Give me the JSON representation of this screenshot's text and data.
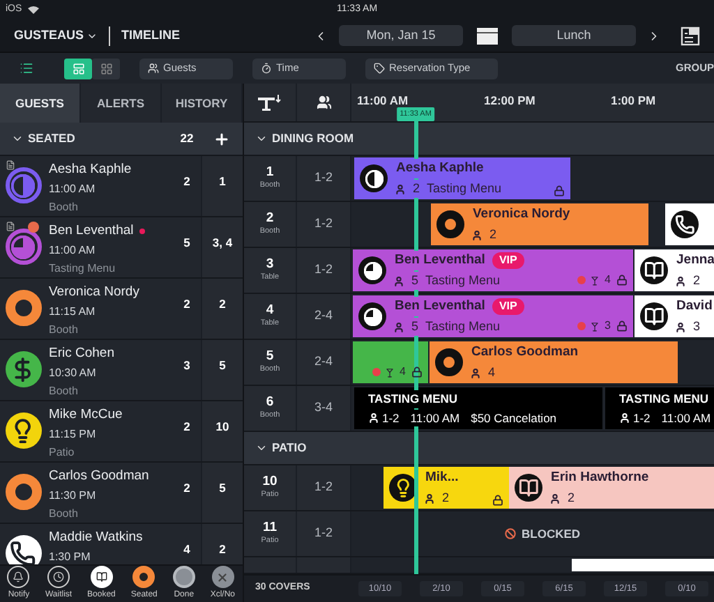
{
  "status_bar": {
    "carrier": "iOS",
    "time": "11:33 AM"
  },
  "header": {
    "venue": "GUSTEAUS",
    "view": "TIMELINE",
    "date": "Mon, Jan 15",
    "shift": "Lunch"
  },
  "toolbar": {
    "views": [
      {
        "kind": "timeline",
        "selected": true
      },
      {
        "kind": "grid",
        "selected": false
      }
    ],
    "filters": [
      {
        "label": "Guests",
        "kind": "guests"
      },
      {
        "label": "Time",
        "kind": "time"
      },
      {
        "label": "Reservation Type",
        "kind": "type"
      }
    ],
    "group": "GROUP"
  },
  "left_tabs": [
    {
      "label": "GUESTS",
      "selected": true
    },
    {
      "label": "ALERTS",
      "selected": false
    },
    {
      "label": "HISTORY",
      "selected": false
    }
  ],
  "section": {
    "title": "SEATED",
    "count": "22",
    "expanded": true
  },
  "guests": [
    {
      "name": "Aesha Kaphle",
      "time": "11:00 AM",
      "note": "Booth",
      "party": "2",
      "table": "1",
      "kind": "half",
      "color": "#7b5cf0",
      "has_note": true,
      "alert": false
    },
    {
      "name": "Ben Leventhal",
      "time": "11:00 AM",
      "note": "Tasting Menu",
      "party": "5",
      "table": "3, 4",
      "kind": "pie",
      "color": "#b450d6",
      "has_note": true,
      "alert": true
    },
    {
      "name": "Veronica Nordy",
      "time": "11:15 AM",
      "note": "Booth",
      "party": "2",
      "table": "2",
      "kind": "ring",
      "color": "#f5883a",
      "has_note": false,
      "alert": false
    },
    {
      "name": "Eric Cohen",
      "time": "10:30 AM",
      "note": "Booth",
      "party": "3",
      "table": "5",
      "kind": "dollar",
      "color": "#45b649",
      "has_note": false,
      "alert": false
    },
    {
      "name": "Mike McCue",
      "time": "11:15 PM",
      "note": "Patio",
      "party": "2",
      "table": "10",
      "kind": "bulb",
      "color": "#f2d40c",
      "has_note": false,
      "alert": false
    },
    {
      "name": "Carlos Goodman",
      "time": "11:30 PM",
      "note": "Booth",
      "party": "2",
      "table": "5",
      "kind": "ring",
      "color": "#f5883a",
      "has_note": false,
      "alert": false
    },
    {
      "name": "Maddie Watkins",
      "time": "1:30 PM",
      "party": "4",
      "table": "2",
      "kind": "phone",
      "color": "#ffffff",
      "has_note": false,
      "alert": false
    }
  ],
  "legend": [
    {
      "label": "Notify",
      "kind": "bell"
    },
    {
      "label": "Waitlist",
      "kind": "clock"
    },
    {
      "label": "Booked",
      "kind": "book"
    },
    {
      "label": "Seated",
      "kind": "seated"
    },
    {
      "label": "Done",
      "kind": "done"
    },
    {
      "label": "Xcl/No",
      "kind": "cancel"
    }
  ],
  "timeline": {
    "times": [
      "11:00 AM",
      "12:00 PM",
      "1:00 PM"
    ],
    "now": "11:33 AM",
    "sections": [
      {
        "title": "DINING ROOM",
        "expanded": true,
        "tables": [
          {
            "number": "1",
            "type": "Booth",
            "size": "1-2",
            "blocks": [
              {
                "kind": "reservation",
                "name": "Aesha Kaphle",
                "party": "2",
                "note": "Tasting Menu",
                "icon": {
                  "kind": "half"
                },
                "color": "#7b5cf0",
                "locked": true,
                "alert": false
              }
            ]
          },
          {
            "number": "2",
            "type": "Booth",
            "size": "1-2",
            "blocks": [
              {
                "kind": "reservation",
                "name": "Veronica Nordy",
                "party": "2",
                "icon": {
                  "kind": "ring"
                },
                "color": "#f5883a",
                "locked": false,
                "alert": false
              },
              {
                "kind": "reservation",
                "icon": {
                  "kind": "phone"
                },
                "color": "#ffffff",
                "locked": false,
                "alert": false
              }
            ]
          },
          {
            "number": "3",
            "type": "Table",
            "size": "1-2",
            "blocks": [
              {
                "kind": "reservation",
                "name": "Ben Leventhal",
                "badge": "VIP",
                "party": "5",
                "note": "Tasting Menu",
                "drinks": "4",
                "icon": {
                  "kind": "pie"
                },
                "color": "#b450d6",
                "locked": true,
                "alert": true
              },
              {
                "kind": "reservation",
                "name": "Jenna",
                "party": "2",
                "icon": {
                  "kind": "book"
                },
                "color": "#ffffff",
                "locked": false,
                "alert": false
              }
            ]
          },
          {
            "number": "4",
            "type": "Table",
            "size": "2-4",
            "blocks": [
              {
                "kind": "reservation",
                "name": "Ben Leventhal",
                "badge": "VIP",
                "party": "5",
                "note": "Tasting Menu",
                "drinks": "3",
                "icon": {
                  "kind": "pie"
                },
                "color": "#b450d6",
                "locked": true,
                "alert": true
              },
              {
                "kind": "reservation",
                "name": "David",
                "party": "3",
                "icon": {
                  "kind": "book"
                },
                "color": "#ffffff",
                "locked": false,
                "alert": false
              }
            ]
          },
          {
            "number": "5",
            "type": "Booth",
            "size": "2-4",
            "blocks": [
              {
                "kind": "reservation",
                "drinks": "4",
                "color": "#45b649",
                "locked": true,
                "alert": true
              },
              {
                "kind": "reservation",
                "name": "Carlos Goodman",
                "party": "4",
                "icon": {
                  "kind": "ring"
                },
                "color": "#f5883a",
                "locked": false,
                "alert": false
              }
            ]
          },
          {
            "number": "6",
            "type": "Booth",
            "size": "3-4",
            "blocks": [
              {
                "kind": "info",
                "title": "TASTING MENU",
                "party": "1-2",
                "time": "11:00 AM",
                "fee": "$50 Cancelation"
              },
              {
                "kind": "info",
                "title": "TASTING MENU",
                "party": "1-2",
                "time": "11:00 AM"
              }
            ]
          }
        ]
      },
      {
        "title": "PATIO",
        "expanded": true,
        "tables": [
          {
            "number": "10",
            "type": "Patio",
            "size": "1-2",
            "blocks": [
              {
                "kind": "reservation",
                "name": "Mik...",
                "party": "2",
                "icon": {
                  "kind": "bulb"
                },
                "color": "#f7d70e",
                "locked": true,
                "alert": false
              },
              {
                "kind": "reservation",
                "name": "Erin Hawthorne",
                "party": "2",
                "icon": {
                  "kind": "book"
                },
                "color": "#f6c6c0",
                "locked": false,
                "alert": false
              }
            ]
          },
          {
            "number": "11",
            "type": "Patio",
            "size": "1-2",
            "blocks": [
              {
                "kind": "blocked",
                "label": "BLOCKED"
              }
            ]
          },
          {
            "partial": true,
            "blocks": [
              {
                "kind": "reservation",
                "color": "#ffffff",
                "locked": false,
                "alert": false
              }
            ]
          }
        ]
      }
    ],
    "covers": "30 COVERS",
    "counts": [
      "10/10",
      "2/10",
      "0/15",
      "6/15",
      "12/15",
      "0/10"
    ]
  }
}
